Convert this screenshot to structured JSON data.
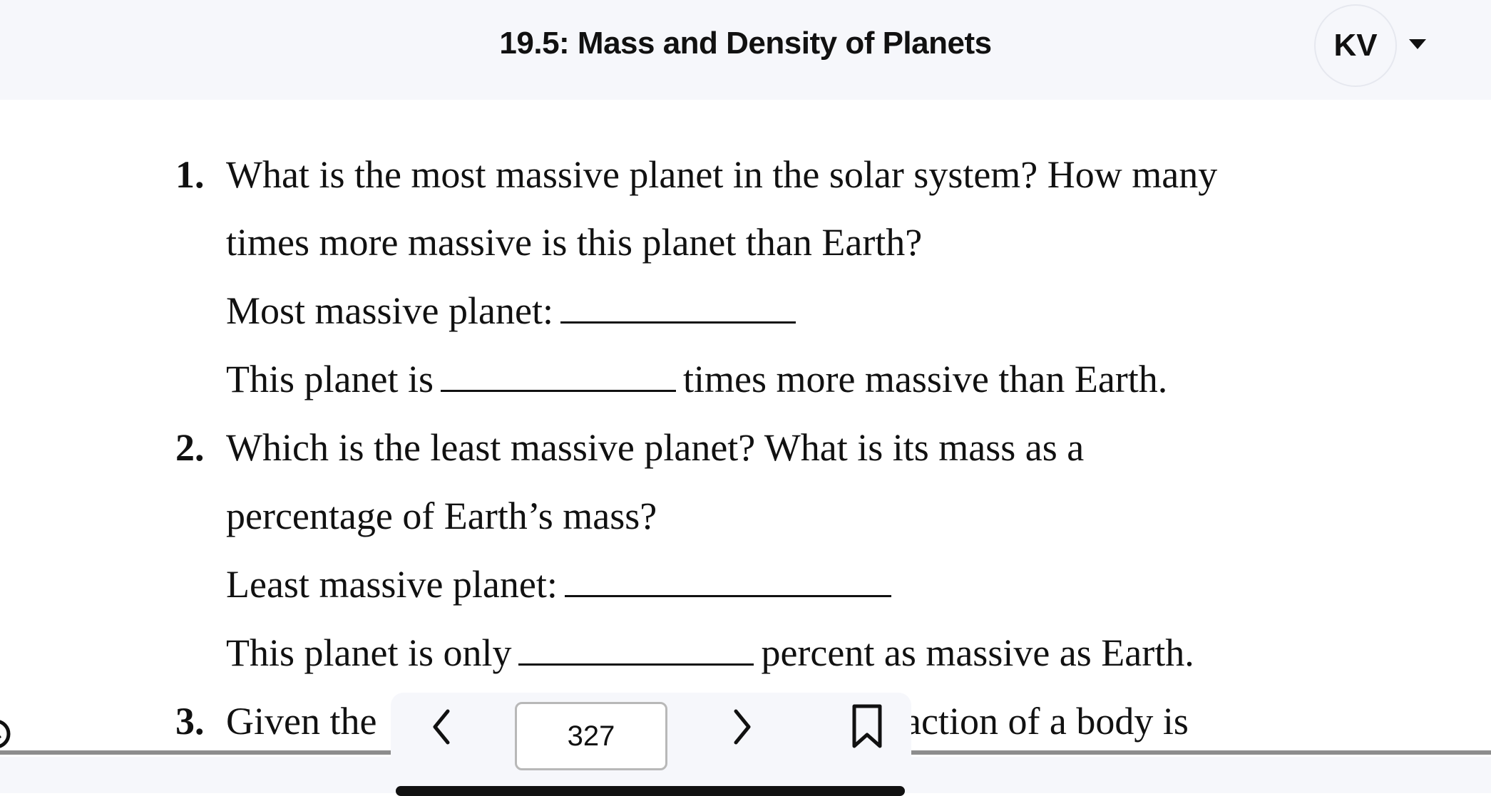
{
  "header": {
    "title": "19.5: Mass and Density of Planets",
    "avatar_initials": "KV",
    "menu_icon": "caret-down-icon"
  },
  "questions": [
    {
      "number": "1.",
      "line1": "What is the most massive planet in the solar system? How many",
      "line2": "times more massive is this planet than Earth?",
      "fill1_label": "Most massive planet:",
      "fill2_prefix": "This planet is",
      "fill2_suffix": "times more massive than Earth."
    },
    {
      "number": "2.",
      "line1": "Which is the least massive planet? What is its mass as a",
      "line2": "percentage of Earth’s mass?",
      "fill1_label": "Least massive planet:",
      "fill2_prefix": "This planet is only",
      "fill2_suffix": "percent as massive as Earth."
    },
    {
      "number": "3.",
      "visible_start": "Given the",
      "visible_end": "action of a body is"
    }
  ],
  "toolbar": {
    "prev_icon": "chevron-left-icon",
    "page_number": "327",
    "next_icon": "chevron-right-icon",
    "bookmark_icon": "bookmark-icon"
  }
}
